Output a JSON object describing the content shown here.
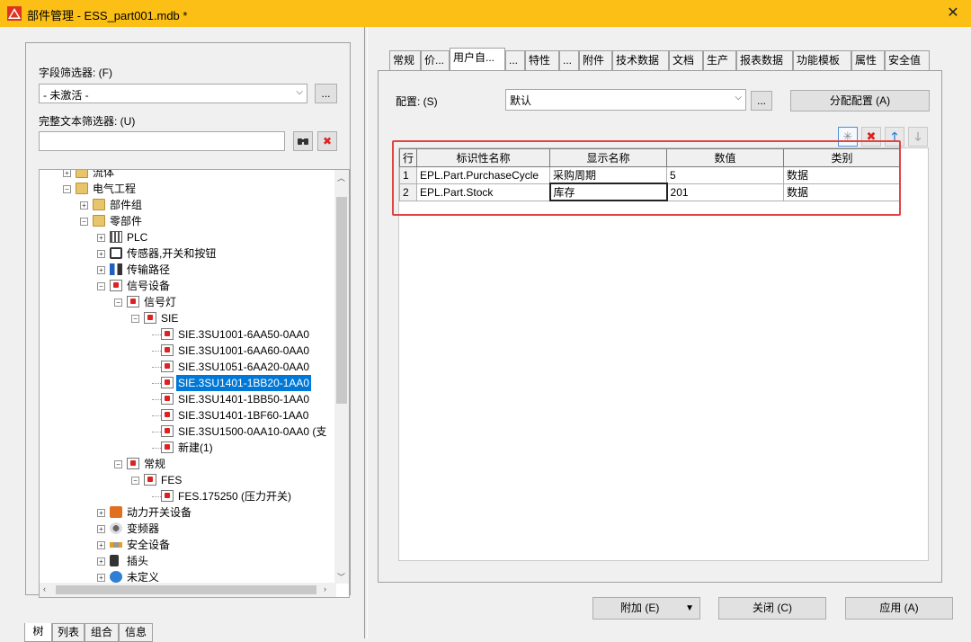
{
  "window": {
    "title": "部件管理 - ESS_part001.mdb *"
  },
  "left": {
    "field_filter_label": "字段筛选器: (F)",
    "field_filter_value": "- 未激活 -",
    "fulltext_filter_label": "完整文本筛选器: (U)",
    "fulltext_value": "",
    "ellipsis": "...",
    "tree": [
      {
        "label": "流体"
      },
      {
        "label": "电气工程"
      },
      {
        "label": "部件组"
      },
      {
        "label": "零部件"
      },
      {
        "label": "PLC"
      },
      {
        "label": "传感器,开关和按钮"
      },
      {
        "label": "传输路径"
      },
      {
        "label": "信号设备"
      },
      {
        "label": "信号灯"
      },
      {
        "label": "SIE"
      },
      {
        "label": "SIE.3SU1001-6AA50-0AA0"
      },
      {
        "label": "SIE.3SU1001-6AA60-0AA0"
      },
      {
        "label": "SIE.3SU1051-6AA20-0AA0"
      },
      {
        "label": "SIE.3SU1401-1BB20-1AA0"
      },
      {
        "label": "SIE.3SU1401-1BB50-1AA0"
      },
      {
        "label": "SIE.3SU1401-1BF60-1AA0"
      },
      {
        "label": "SIE.3SU1500-0AA10-0AA0 (支"
      },
      {
        "label": "新建(1)"
      },
      {
        "label": "常规"
      },
      {
        "label": "FES"
      },
      {
        "label": "FES.175250 (压力开关)"
      },
      {
        "label": "动力开关设备"
      },
      {
        "label": "变频器"
      },
      {
        "label": "安全设备"
      },
      {
        "label": "插头"
      },
      {
        "label": "未定义"
      }
    ],
    "bottom_tabs": [
      "树",
      "列表",
      "组合",
      "信息"
    ]
  },
  "right": {
    "tabs": [
      "常规",
      "价...",
      "用户自...",
      "...",
      "特性",
      "...",
      "附件",
      "技术数据",
      "文档",
      "生产",
      "报表数据",
      "功能模板",
      "属性",
      "安全值"
    ],
    "config_label": "配置: (S)",
    "config_value": "默认",
    "ellipsis": "...",
    "assign_button": "分配配置 (A)",
    "table": {
      "headers": [
        "行",
        "标识性名称",
        "显示名称",
        "数值",
        "类别"
      ],
      "rows": [
        [
          "1",
          "EPL.Part.PurchaseCycle",
          "采购周期",
          "5",
          "数据"
        ],
        [
          "2",
          "EPL.Part.Stock",
          "库存",
          "201",
          "数据"
        ]
      ]
    }
  },
  "footer": {
    "attach": "附加 (E)",
    "close": "关闭 (C)",
    "apply": "应用 (A)"
  }
}
